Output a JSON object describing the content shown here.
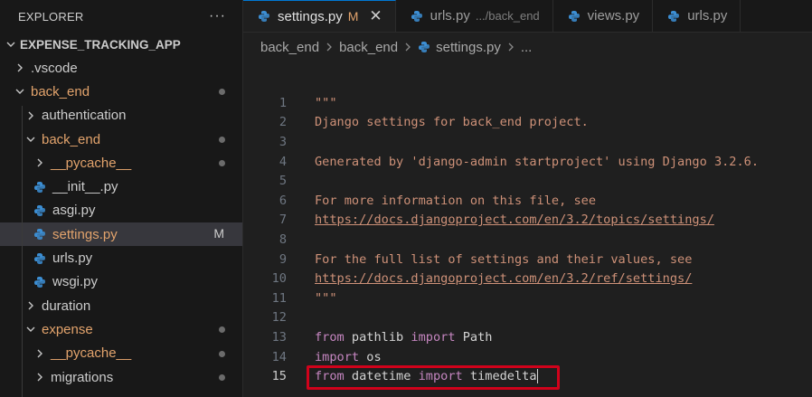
{
  "explorer": {
    "title": "EXPLORER",
    "more_label": "···",
    "root": "EXPENSE_TRACKING_APP",
    "items": [
      {
        "label": ".vscode",
        "kind": "folder",
        "expanded": false,
        "depth": 1,
        "color": "#cccccc",
        "badge": ""
      },
      {
        "label": "back_end",
        "kind": "folder",
        "expanded": true,
        "depth": 1,
        "color": "#e2a36c",
        "badge": "dot"
      },
      {
        "label": "authentication",
        "kind": "folder",
        "expanded": false,
        "depth": 2,
        "color": "#cccccc",
        "badge": ""
      },
      {
        "label": "back_end",
        "kind": "folder",
        "expanded": true,
        "depth": 2,
        "color": "#e2a36c",
        "badge": "dot"
      },
      {
        "label": "__pycache__",
        "kind": "folder",
        "expanded": false,
        "depth": 3,
        "color": "#e2a36c",
        "badge": "dot"
      },
      {
        "label": "__init__.py",
        "kind": "python",
        "depth": 3,
        "color": "#cccccc",
        "badge": ""
      },
      {
        "label": "asgi.py",
        "kind": "python",
        "depth": 3,
        "color": "#cccccc",
        "badge": ""
      },
      {
        "label": "settings.py",
        "kind": "python",
        "depth": 3,
        "color": "#e2a36c",
        "badge": "M",
        "selected": true
      },
      {
        "label": "urls.py",
        "kind": "python",
        "depth": 3,
        "color": "#cccccc",
        "badge": ""
      },
      {
        "label": "wsgi.py",
        "kind": "python",
        "depth": 3,
        "color": "#cccccc",
        "badge": ""
      },
      {
        "label": "duration",
        "kind": "folder",
        "expanded": false,
        "depth": 2,
        "color": "#cccccc",
        "badge": ""
      },
      {
        "label": "expense",
        "kind": "folder",
        "expanded": true,
        "depth": 2,
        "color": "#e2a36c",
        "badge": "dot"
      },
      {
        "label": "__pycache__",
        "kind": "folder",
        "expanded": false,
        "depth": 3,
        "color": "#e2a36c",
        "badge": "dot"
      },
      {
        "label": "migrations",
        "kind": "folder",
        "expanded": false,
        "depth": 3,
        "color": "#cccccc",
        "badge": "dot"
      }
    ]
  },
  "tabs": [
    {
      "label": "settings.py",
      "mark": "M",
      "hint": "",
      "active": true
    },
    {
      "label": "urls.py",
      "mark": "",
      "hint": ".../back_end",
      "active": false
    },
    {
      "label": "views.py",
      "mark": "",
      "hint": "",
      "active": false
    },
    {
      "label": "urls.py",
      "mark": "",
      "hint": "",
      "active": false
    }
  ],
  "close_label": "✕",
  "breadcrumb": [
    "back_end",
    "back_end",
    "settings.py",
    "..."
  ],
  "code": {
    "current_line": 15,
    "lines": [
      {
        "n": "1",
        "segs": [
          {
            "t": "\"\"\"",
            "c": "str"
          }
        ]
      },
      {
        "n": "2",
        "segs": [
          {
            "t": "Django settings for back_end project.",
            "c": "str"
          }
        ]
      },
      {
        "n": "3",
        "segs": []
      },
      {
        "n": "4",
        "segs": [
          {
            "t": "Generated by 'django-admin startproject' using Django 3.2.6.",
            "c": "str"
          }
        ]
      },
      {
        "n": "5",
        "segs": []
      },
      {
        "n": "6",
        "segs": [
          {
            "t": "For more information on this file, see",
            "c": "str"
          }
        ]
      },
      {
        "n": "7",
        "segs": [
          {
            "t": "https://docs.djangoproject.com/en/3.2/topics/settings/",
            "c": "link"
          }
        ]
      },
      {
        "n": "8",
        "segs": []
      },
      {
        "n": "9",
        "segs": [
          {
            "t": "For the full list of settings and their values, see",
            "c": "str"
          }
        ]
      },
      {
        "n": "10",
        "segs": [
          {
            "t": "https://docs.djangoproject.com/en/3.2/ref/settings/",
            "c": "link"
          }
        ]
      },
      {
        "n": "11",
        "segs": [
          {
            "t": "\"\"\"",
            "c": "str"
          }
        ]
      },
      {
        "n": "12",
        "segs": []
      },
      {
        "n": "13",
        "segs": [
          {
            "t": "from",
            "c": "kw"
          },
          {
            "t": " pathlib ",
            "c": "id"
          },
          {
            "t": "import",
            "c": "kw"
          },
          {
            "t": " Path",
            "c": "id"
          }
        ]
      },
      {
        "n": "14",
        "segs": [
          {
            "t": "import",
            "c": "kw"
          },
          {
            "t": " os",
            "c": "id"
          }
        ]
      },
      {
        "n": "15",
        "segs": [
          {
            "t": "from",
            "c": "kw"
          },
          {
            "t": " datetime ",
            "c": "id"
          },
          {
            "t": "import",
            "c": "kw"
          },
          {
            "t": " timedelta",
            "c": "id"
          }
        ]
      }
    ]
  },
  "colors": {
    "accent": "#0078d4",
    "highlight": "#d0021b",
    "modified": "#e2a36c"
  }
}
